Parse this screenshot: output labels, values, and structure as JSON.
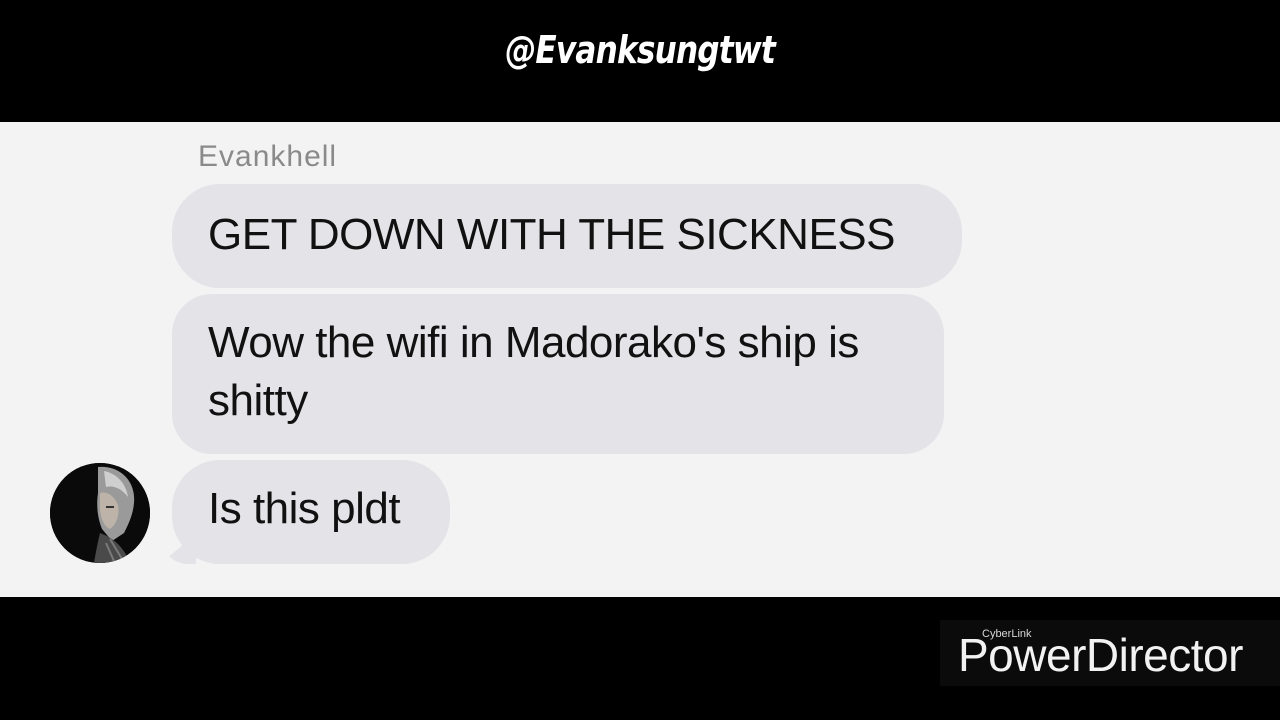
{
  "header": {
    "handle": "@Evanksungtwt"
  },
  "chat": {
    "sender_name": "Evankhell",
    "messages": [
      {
        "text": "GET DOWN WITH THE SICKNESS"
      },
      {
        "text": "Wow the wifi in Madorako's ship is shitty"
      },
      {
        "text": "Is this pldt"
      }
    ]
  },
  "watermark": {
    "small": "CyberLink",
    "brand": "PowerDirector"
  },
  "colors": {
    "letterbox": "#000000",
    "chat_background": "#f3f3f3",
    "bubble": "#e3e3e8",
    "sender_name": "#8a8a8a"
  }
}
